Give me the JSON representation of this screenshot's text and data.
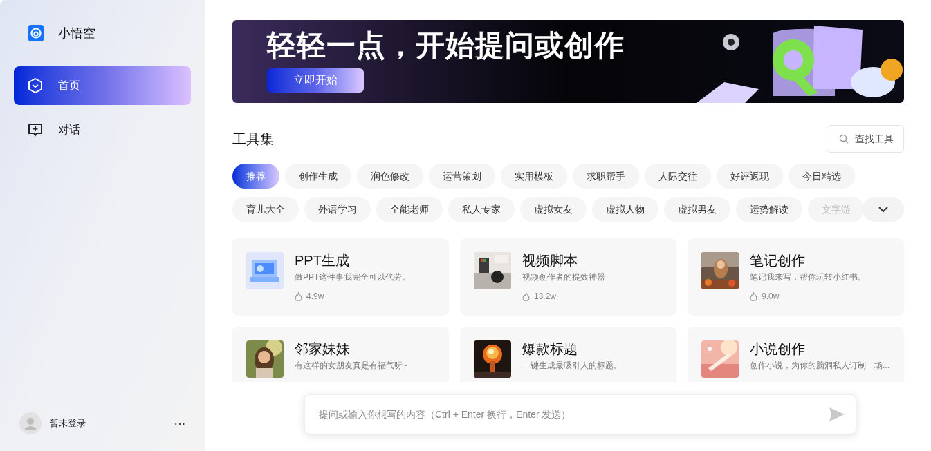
{
  "sidebar": {
    "app_name": "小悟空",
    "items": [
      {
        "label": "首页",
        "selected": true
      },
      {
        "label": "对话",
        "selected": false
      }
    ],
    "user": {
      "name": "暂未登录",
      "more": "···"
    }
  },
  "banner": {
    "headline": "轻轻一点，开始提问或创作",
    "button": "立即开始"
  },
  "tools": {
    "title": "工具集",
    "search_placeholder": "查找工具",
    "categories": [
      {
        "label": "推荐",
        "selected": true
      },
      {
        "label": "创作生成",
        "selected": false
      },
      {
        "label": "润色修改",
        "selected": false
      },
      {
        "label": "运营策划",
        "selected": false
      },
      {
        "label": "实用模板",
        "selected": false
      },
      {
        "label": "求职帮手",
        "selected": false
      },
      {
        "label": "人际交往",
        "selected": false
      },
      {
        "label": "好评返现",
        "selected": false
      },
      {
        "label": "今日精选",
        "selected": false
      },
      {
        "label": "育儿大全",
        "selected": false
      },
      {
        "label": "外语学习",
        "selected": false
      },
      {
        "label": "全能老师",
        "selected": false
      },
      {
        "label": "私人专家",
        "selected": false
      },
      {
        "label": "虚拟女友",
        "selected": false
      },
      {
        "label": "虚拟人物",
        "selected": false
      },
      {
        "label": "虚拟男友",
        "selected": false
      },
      {
        "label": "运势解读",
        "selected": false
      },
      {
        "label": "文字游",
        "selected": false
      }
    ],
    "cards": [
      {
        "title": "PPT生成",
        "description": "做PPT这件事我完全可以代劳。",
        "count": "4.9w"
      },
      {
        "title": "视频脚本",
        "description": "视频创作者的提效神器",
        "count": "13.2w"
      },
      {
        "title": "笔记创作",
        "description": "笔记我来写，帮你玩转小红书。",
        "count": "9.0w"
      },
      {
        "title": "邻家妹妹",
        "description": "有这样的女朋友真是有福气呀~"
      },
      {
        "title": "爆款标题",
        "description": "一键生成最吸引人的标题。"
      },
      {
        "title": "小说创作",
        "description": "创作小说，为你的脑洞私人订制一场..."
      }
    ]
  },
  "composer": {
    "placeholder": "提问或输入你想写的内容（Ctrl + Enter 换行，Enter 发送）"
  }
}
